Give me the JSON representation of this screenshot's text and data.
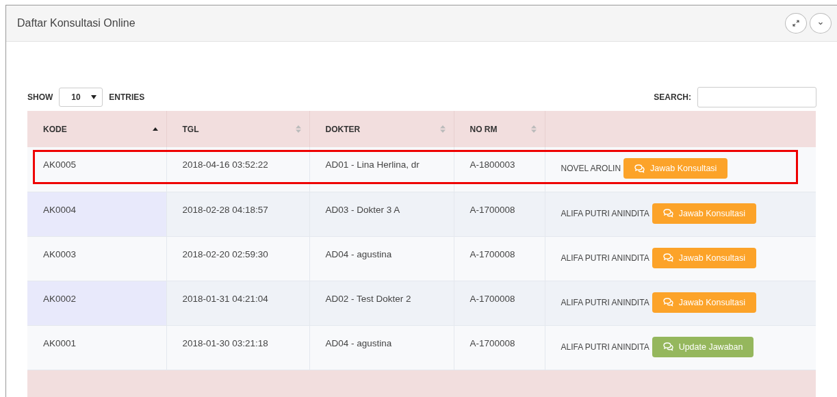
{
  "panel": {
    "title": "Daftar Konsultasi Online"
  },
  "length_control": {
    "show_label": "SHOW",
    "value": "10",
    "entries_label": "ENTRIES"
  },
  "search": {
    "label": "SEARCH:"
  },
  "table": {
    "columns": [
      {
        "label": "KODE",
        "sorted": true
      },
      {
        "label": "TGL",
        "sorted": false
      },
      {
        "label": "DOKTER",
        "sorted": false
      },
      {
        "label": "NO RM",
        "sorted": false
      }
    ],
    "rows": [
      {
        "kode": "AK0005",
        "tgl": "2018-04-16 03:52:22",
        "dokter": "AD01 - Lina Herlina, dr",
        "no_rm": "A-1800003",
        "pasien": "NOVEL AROLIN",
        "action": {
          "kind": "answer",
          "label": "Jawab Konsultasi"
        },
        "highlighted": true
      },
      {
        "kode": "AK0004",
        "tgl": "2018-02-28 04:18:57",
        "dokter": "AD03 - Dokter 3 A",
        "no_rm": "A-1700008",
        "pasien": "ALIFA PUTRI ANINDITA",
        "action": {
          "kind": "answer",
          "label": "Jawab Konsultasi"
        },
        "highlighted": false
      },
      {
        "kode": "AK0003",
        "tgl": "2018-02-20 02:59:30",
        "dokter": "AD04 - agustina",
        "no_rm": "A-1700008",
        "pasien": "ALIFA PUTRI ANINDITA",
        "action": {
          "kind": "answer",
          "label": "Jawab Konsultasi"
        },
        "highlighted": false
      },
      {
        "kode": "AK0002",
        "tgl": "2018-01-31 04:21:04",
        "dokter": "AD02 - Test Dokter 2",
        "no_rm": "A-1700008",
        "pasien": "ALIFA PUTRI ANINDITA",
        "action": {
          "kind": "answer",
          "label": "Jawab Konsultasi"
        },
        "highlighted": false
      },
      {
        "kode": "AK0001",
        "tgl": "2018-01-30 03:21:18",
        "dokter": "AD04 - agustina",
        "no_rm": "A-1700008",
        "pasien": "ALIFA PUTRI ANINDITA",
        "action": {
          "kind": "update",
          "label": "Update Jawaban"
        },
        "highlighted": false
      }
    ]
  }
}
